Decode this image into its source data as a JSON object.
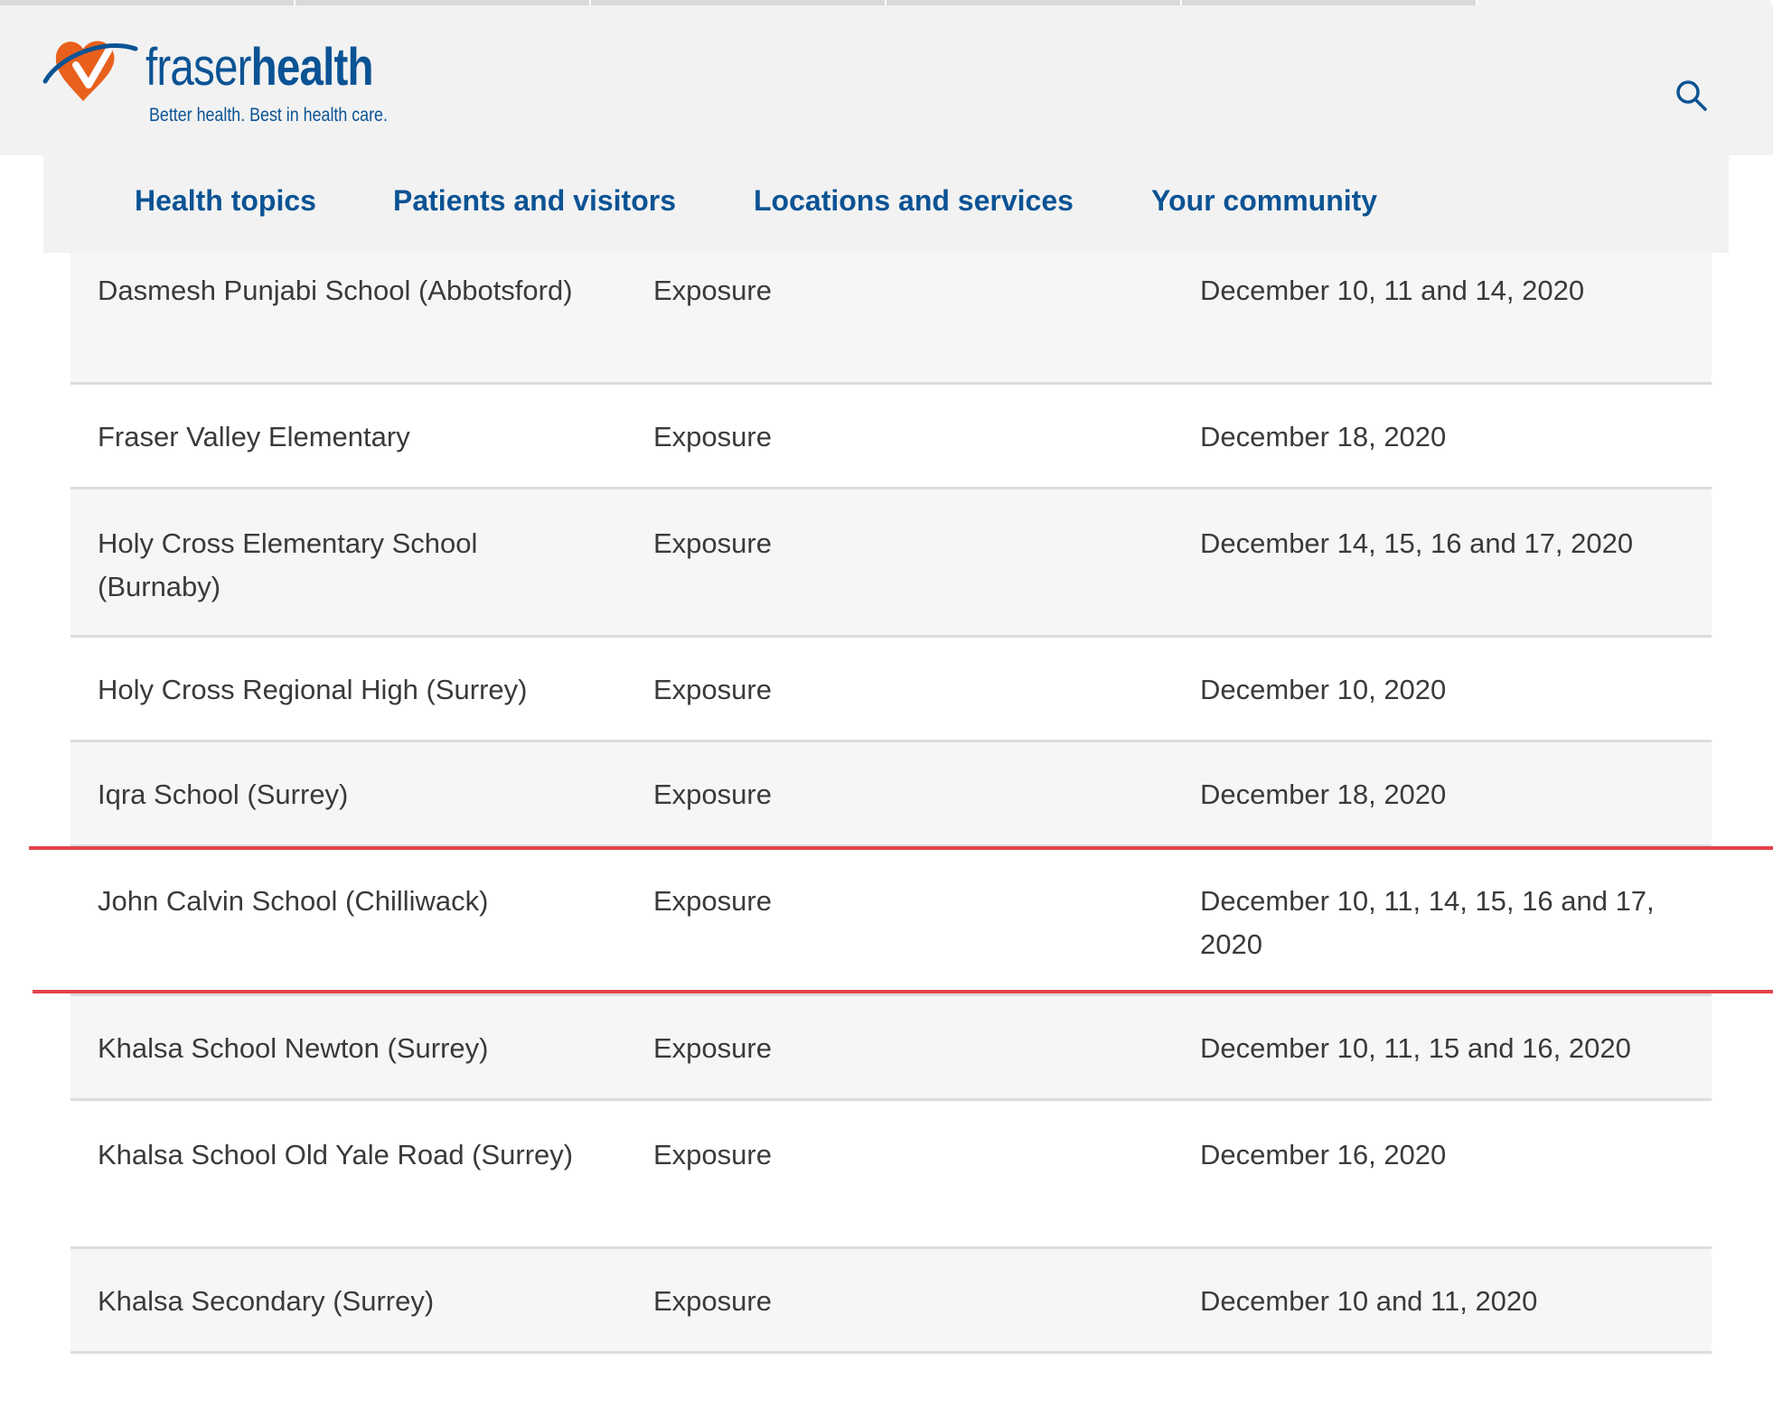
{
  "header": {
    "brand_light": "fraser",
    "brand_bold": "health",
    "tagline": "Better health. Best in health care.",
    "brand_color": "#0b5394",
    "logo_accent": "#e8601c",
    "search_icon": "search-icon"
  },
  "nav": {
    "items": [
      {
        "label": "Health topics"
      },
      {
        "label": "Patients and visitors"
      },
      {
        "label": "Locations and services"
      },
      {
        "label": "Your community"
      }
    ]
  },
  "table": {
    "rows": [
      {
        "school": "Dasmesh Punjabi School (Abbotsford)",
        "type": "Exposure",
        "dates": "December 10, 11 and 14, 2020"
      },
      {
        "school": "Fraser Valley Elementary",
        "type": "Exposure",
        "dates": "December 18, 2020"
      },
      {
        "school": "Holy Cross Elementary School (Burnaby)",
        "type": "Exposure",
        "dates": "December 14, 15, 16 and 17, 2020"
      },
      {
        "school": "Holy Cross Regional High (Surrey)",
        "type": "Exposure",
        "dates": "December 10, 2020"
      },
      {
        "school": "Iqra School (Surrey)",
        "type": "Exposure",
        "dates": "December 18, 2020"
      },
      {
        "school": "John Calvin School (Chilliwack)",
        "type": "Exposure",
        "dates": "December 10, 11, 14, 15, 16 and 17, 2020"
      },
      {
        "school": "Khalsa School Newton (Surrey)",
        "type": "Exposure",
        "dates": "December 10, 11, 15 and 16, 2020"
      },
      {
        "school": "Khalsa School Old Yale Road (Surrey)",
        "type": "Exposure",
        "dates": "December 16, 2020"
      },
      {
        "school": "Khalsa Secondary (Surrey)",
        "type": "Exposure",
        "dates": "December 10 and 11, 2020"
      }
    ]
  },
  "highlight_color": "#e2434b"
}
